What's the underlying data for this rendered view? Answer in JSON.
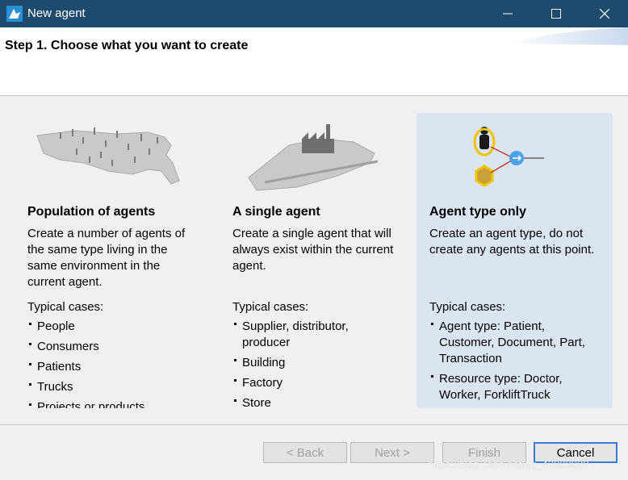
{
  "window": {
    "title": "New agent",
    "controls": {
      "minimize": "—",
      "maximize": "☐",
      "close": "✕"
    }
  },
  "header": {
    "step_title": "Step 1. Choose what you want to create"
  },
  "options": [
    {
      "title": "Population of agents",
      "description": "Create a number of agents of the same type living in the same environment in the current agent.",
      "cases_label": "Typical cases:",
      "cases": [
        "People",
        "Consumers",
        "Patients",
        "Trucks",
        "Projects or products"
      ],
      "selected": false
    },
    {
      "title": "A single agent",
      "description": "Create a single agent that will always exist within the current agent.",
      "cases_label": "Typical cases:",
      "cases": [
        "Supplier, distributor, producer",
        "Building",
        "Factory",
        "Store"
      ],
      "selected": false
    },
    {
      "title": "Agent type only",
      "description": "Create an agent type, do not create any agents at this point.",
      "cases_label": "Typical cases:",
      "cases": [
        "Agent type: Patient, Customer, Document, Part, Transaction",
        "Resource type: Doctor, Worker, ForkliftTruck"
      ],
      "selected": true
    }
  ],
  "buttons": {
    "back": "< Back",
    "next": "Next >",
    "finish": "Finish",
    "cancel": "Cancel"
  },
  "watermark": "https://blog.csdn.net/qq_43809930",
  "colors": {
    "titlebar": "#1e4a6d",
    "selected_panel": "#dbe5f1",
    "default_button_border": "#3b7bd8"
  },
  "icons": [
    "anylogic-logo-icon",
    "minimize-icon",
    "maximize-icon",
    "close-icon",
    "usa-map-people-icon",
    "factory-terrain-icon",
    "agent-type-icon"
  ]
}
